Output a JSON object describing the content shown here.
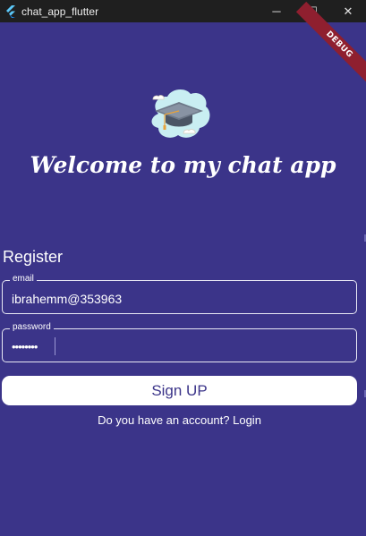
{
  "window": {
    "title": "chat_app_flutter",
    "controls": {
      "minimize": "─",
      "maximize": "☐",
      "close": "✕"
    }
  },
  "debug_banner": "DEBUG",
  "header": {
    "welcome": "Welcome to my chat app"
  },
  "form": {
    "title": "Register",
    "email": {
      "label": "email",
      "value": "ibrahemm@353963"
    },
    "password": {
      "label": "password",
      "value": "••••••••"
    },
    "signup_label": "Sign UP",
    "login_prompt": "Do you have an account? Login"
  },
  "colors": {
    "background": "#3b3489",
    "titlebar": "#1f1f1f",
    "button": "#ffffff",
    "debug_banner": "#8f1f2f"
  },
  "icons": [
    "flutter-icon",
    "graduation-cap-logo-icon"
  ]
}
